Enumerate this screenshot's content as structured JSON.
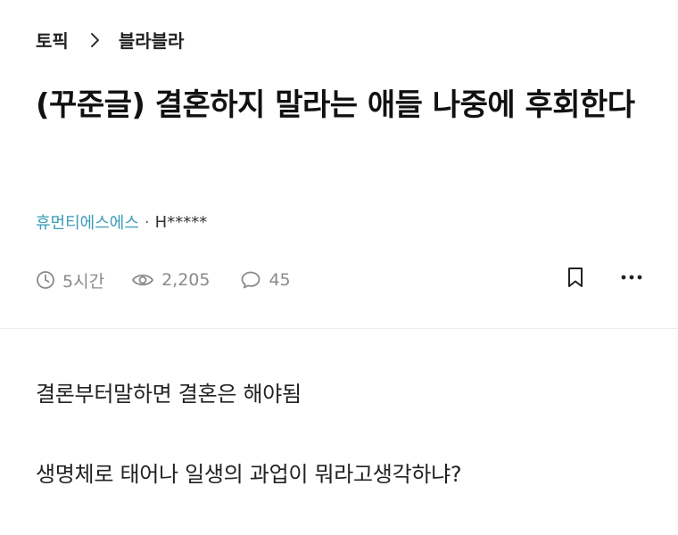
{
  "breadcrumb": {
    "section": "토픽",
    "separator_icon": "chevron-right-icon",
    "topic": "블라블라"
  },
  "post": {
    "title": "(꾸준글) 결혼하지 말라는 애들 나중에 후회한다",
    "company": "휴먼티에스에스",
    "separator": "·",
    "author": "H*****"
  },
  "stats": {
    "time": "5시간",
    "time_icon": "clock-icon",
    "views": "2,205",
    "views_icon": "eye-icon",
    "comments": "45",
    "comments_icon": "speech-bubble-icon"
  },
  "actions": {
    "bookmark_icon": "bookmark-icon",
    "more_icon": "more-horizontal-icon"
  },
  "content": {
    "paragraphs": [
      "결론부터말하면 결혼은 해야됨",
      "생명체로 태어나 일생의 과업이 뭐라고생각하냐?"
    ]
  },
  "colors": {
    "company": "#3a9bb8",
    "meta_gray": "#8a8a8a",
    "text": "#111111"
  }
}
